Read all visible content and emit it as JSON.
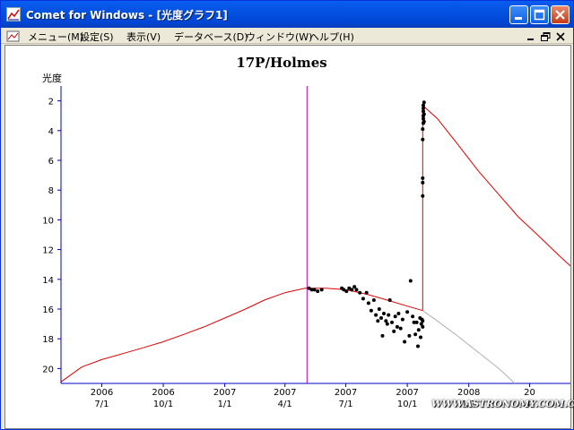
{
  "window": {
    "title": "Comet for Windows - [光度グラフ1]"
  },
  "menu": {
    "items": [
      "メニュー(M)",
      "設定(S)",
      "表示(V)",
      "データベース(D)",
      "ウィンドウ(W)",
      "ヘルプ(H)"
    ]
  },
  "colors": {
    "titlebar": "#0054e3",
    "model_curve": "#e00000",
    "alt_curve": "#b0b0b0",
    "today_line": "#c000c0",
    "observations": "#000000",
    "axis": "#0000c0"
  },
  "watermark": "WWW.ASTRONOMY.COM.CN",
  "chart_data": {
    "type": "scatter",
    "title": "17P/Holmes",
    "ylabel": "光度",
    "y_inverted": true,
    "ylim": [
      21,
      1
    ],
    "yticks": [
      2,
      4,
      6,
      8,
      10,
      12,
      14,
      16,
      18,
      20
    ],
    "xlim": [
      "2006-05-01",
      "2008-06-01"
    ],
    "x_ticks": [
      {
        "date": "2006-07-01",
        "top": "2006",
        "bottom": "7/1"
      },
      {
        "date": "2006-10-01",
        "top": "2006",
        "bottom": "10/1"
      },
      {
        "date": "2007-01-01",
        "top": "2007",
        "bottom": "1/1"
      },
      {
        "date": "2007-04-01",
        "top": "2007",
        "bottom": "4/1"
      },
      {
        "date": "2007-07-01",
        "top": "2007",
        "bottom": "7/1"
      },
      {
        "date": "2007-10-01",
        "top": "2007",
        "bottom": "10/1"
      },
      {
        "date": "2008-01-01",
        "top": "2008",
        "bottom": "1/1"
      },
      {
        "date": "2008-04-01",
        "top": "20",
        "bottom": "4/"
      }
    ],
    "vertical_marker": "2007-05-04",
    "outburst_date": "2007-10-24",
    "series": [
      {
        "style": "line",
        "color": "#e00000",
        "points": [
          [
            "2006-05-01",
            20.9
          ],
          [
            "2006-06-01",
            19.9
          ],
          [
            "2006-07-01",
            19.4
          ],
          [
            "2006-08-01",
            19.0
          ],
          [
            "2006-09-01",
            18.6
          ],
          [
            "2006-10-01",
            18.2
          ],
          [
            "2006-11-01",
            17.7
          ],
          [
            "2006-12-01",
            17.2
          ],
          [
            "2007-01-01",
            16.6
          ],
          [
            "2007-02-01",
            16.0
          ],
          [
            "2007-03-01",
            15.4
          ],
          [
            "2007-04-01",
            14.9
          ],
          [
            "2007-05-01",
            14.6
          ],
          [
            "2007-06-01",
            14.6
          ],
          [
            "2007-07-01",
            14.7
          ],
          [
            "2007-08-01",
            15.0
          ],
          [
            "2007-09-01",
            15.4
          ],
          [
            "2007-10-01",
            15.8
          ],
          [
            "2007-10-24",
            16.1
          ]
        ]
      },
      {
        "style": "line",
        "color": "#e00000",
        "points": [
          [
            "2007-10-24",
            16.1
          ],
          [
            "2007-10-24",
            2.3
          ],
          [
            "2007-11-15",
            3.2
          ],
          [
            "2007-12-15",
            4.9
          ],
          [
            "2008-01-15",
            6.7
          ],
          [
            "2008-02-15",
            8.3
          ],
          [
            "2008-03-15",
            9.8
          ],
          [
            "2008-04-15",
            11.1
          ],
          [
            "2008-05-15",
            12.4
          ],
          [
            "2008-06-01",
            13.1
          ]
        ]
      },
      {
        "style": "line",
        "color": "#b0b0b0",
        "points": [
          [
            "2007-10-24",
            16.1
          ],
          [
            "2007-11-15",
            16.8
          ],
          [
            "2007-12-15",
            17.8
          ],
          [
            "2008-01-15",
            18.9
          ],
          [
            "2008-02-15",
            20.0
          ],
          [
            "2008-03-10",
            21.0
          ]
        ]
      },
      {
        "style": "points",
        "color": "#000000",
        "points": [
          [
            "2007-05-07",
            14.6
          ],
          [
            "2007-05-11",
            14.7
          ],
          [
            "2007-05-15",
            14.7
          ],
          [
            "2007-05-20",
            14.8
          ],
          [
            "2007-05-26",
            14.7
          ],
          [
            "2007-06-25",
            14.6
          ],
          [
            "2007-06-28",
            14.7
          ],
          [
            "2007-07-02",
            14.8
          ],
          [
            "2007-07-06",
            14.6
          ],
          [
            "2007-07-10",
            14.7
          ],
          [
            "2007-07-14",
            14.5
          ],
          [
            "2007-07-17",
            14.7
          ],
          [
            "2007-07-22",
            14.9
          ],
          [
            "2007-07-27",
            15.3
          ],
          [
            "2007-08-01",
            14.9
          ],
          [
            "2007-08-04",
            15.6
          ],
          [
            "2007-08-08",
            16.1
          ],
          [
            "2007-08-12",
            15.4
          ],
          [
            "2007-08-15",
            16.4
          ],
          [
            "2007-08-18",
            16.8
          ],
          [
            "2007-08-20",
            16.0
          ],
          [
            "2007-08-23",
            16.6
          ],
          [
            "2007-08-25",
            17.8
          ],
          [
            "2007-08-27",
            16.3
          ],
          [
            "2007-08-30",
            16.8
          ],
          [
            "2007-09-01",
            17.0
          ],
          [
            "2007-09-03",
            16.4
          ],
          [
            "2007-09-05",
            15.4
          ],
          [
            "2007-09-08",
            16.9
          ],
          [
            "2007-09-11",
            17.5
          ],
          [
            "2007-09-13",
            16.5
          ],
          [
            "2007-09-16",
            17.2
          ],
          [
            "2007-09-18",
            16.3
          ],
          [
            "2007-09-21",
            17.3
          ],
          [
            "2007-09-24",
            16.7
          ],
          [
            "2007-09-27",
            18.2
          ],
          [
            "2007-10-01",
            16.2
          ],
          [
            "2007-10-04",
            17.8
          ],
          [
            "2007-10-06",
            14.1
          ],
          [
            "2007-10-09",
            16.5
          ],
          [
            "2007-10-11",
            16.9
          ],
          [
            "2007-10-13",
            17.7
          ],
          [
            "2007-10-15",
            16.9
          ],
          [
            "2007-10-17",
            18.5
          ],
          [
            "2007-10-18",
            17.4
          ],
          [
            "2007-10-20",
            16.6
          ],
          [
            "2007-10-21",
            17.9
          ],
          [
            "2007-10-22",
            17.0
          ],
          [
            "2007-10-23",
            16.7
          ],
          [
            "2007-10-24",
            17.2
          ],
          [
            "2007-10-24",
            16.8
          ],
          [
            "2007-10-24",
            8.4
          ],
          [
            "2007-10-24",
            7.5
          ],
          [
            "2007-10-24",
            7.2
          ],
          [
            "2007-10-24",
            4.6
          ],
          [
            "2007-10-24",
            3.9
          ],
          [
            "2007-10-25",
            3.5
          ],
          [
            "2007-10-25",
            3.2
          ],
          [
            "2007-10-25",
            3.0
          ],
          [
            "2007-10-25",
            2.7
          ],
          [
            "2007-10-25",
            2.5
          ],
          [
            "2007-10-25",
            2.3
          ],
          [
            "2007-10-26",
            2.1
          ],
          [
            "2007-10-26",
            2.9
          ],
          [
            "2007-10-26",
            3.4
          ]
        ]
      }
    ]
  }
}
